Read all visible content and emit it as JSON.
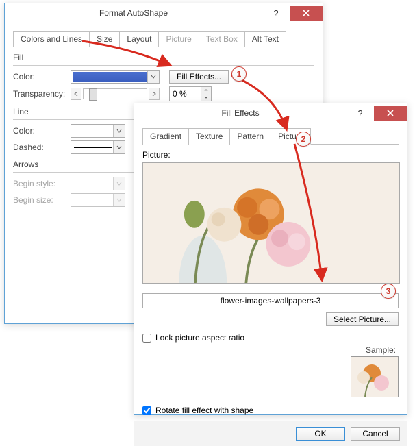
{
  "format_autoshape": {
    "title": "Format AutoShape",
    "tabs": {
      "colors_lines": "Colors and Lines",
      "size": "Size",
      "layout": "Layout",
      "picture": "Picture",
      "text_box": "Text Box",
      "alt_text": "Alt Text"
    },
    "fill": {
      "section": "Fill",
      "color_label": "Color:",
      "fill_effects_btn": "Fill Effects...",
      "transparency_label": "Transparency:",
      "transparency_value": "0 %"
    },
    "line": {
      "section": "Line",
      "color_label": "Color:",
      "dashed_label": "Dashed:"
    },
    "arrows": {
      "section": "Arrows",
      "begin_style": "Begin style:",
      "begin_size": "Begin size:"
    }
  },
  "fill_effects": {
    "title": "Fill Effects",
    "tabs": {
      "gradient": "Gradient",
      "texture": "Texture",
      "pattern": "Pattern",
      "picture": "Picture"
    },
    "picture_label": "Picture:",
    "filename": "flower-images-wallpapers-3",
    "select_picture_btn": "Select Picture...",
    "lock_aspect": "Lock picture aspect ratio",
    "rotate_fill": "Rotate fill effect with shape",
    "sample_label": "Sample:",
    "ok": "OK",
    "cancel": "Cancel"
  },
  "badges": {
    "b1": "1",
    "b2": "2",
    "b3": "3"
  }
}
